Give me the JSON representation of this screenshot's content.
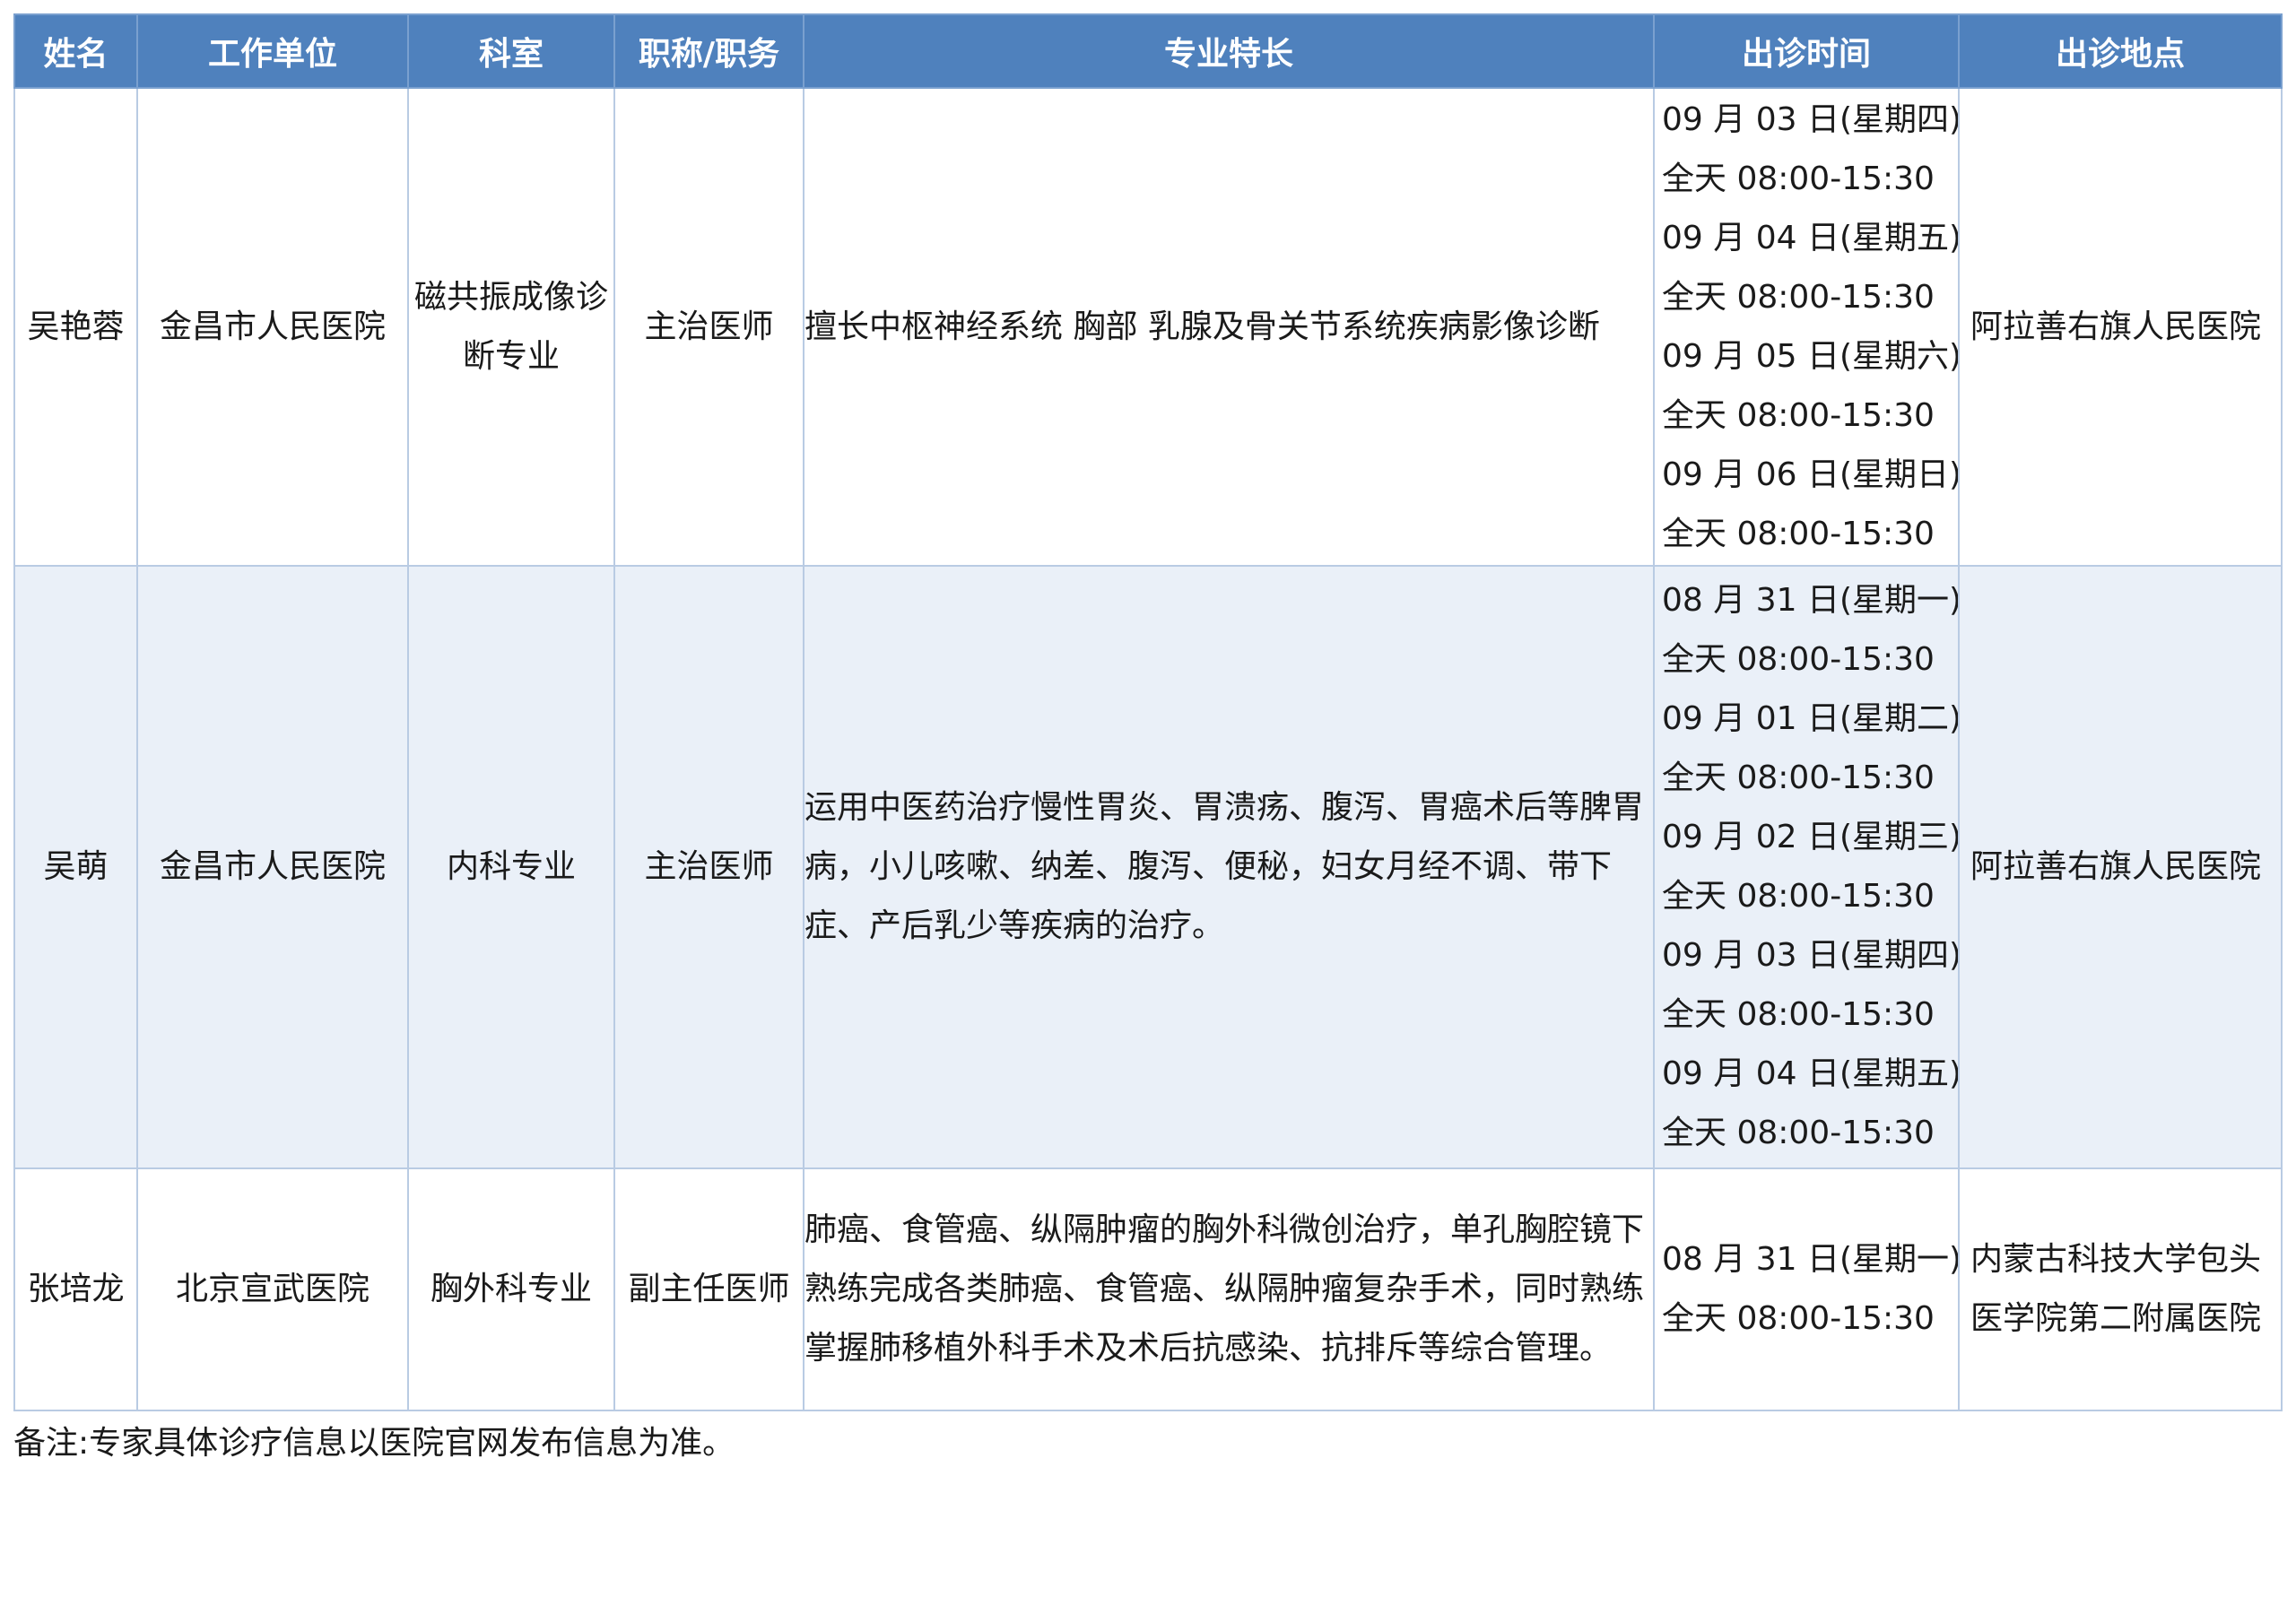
{
  "table": {
    "headers": [
      "姓名",
      "工作单位",
      "科室",
      "职称/职务",
      "专业特长",
      "出诊时间",
      "出诊地点"
    ],
    "rows": [
      {
        "name": "吴艳蓉",
        "unit": "金昌市人民医院",
        "department": "磁共振成像诊断专业",
        "title": "主治医师",
        "specialty": "擅长中枢神经系统 胸部 乳腺及骨关节系统疾病影像诊断",
        "times": [
          "09 月 03 日(星期四)",
          "全天 08:00-15:30",
          "09 月 04 日(星期五)",
          "全天 08:00-15:30",
          "09 月 05 日(星期六)",
          "全天 08:00-15:30",
          "09 月 06 日(星期日)",
          "全天 08:00-15:30"
        ],
        "location": "阿拉善右旗人民医院"
      },
      {
        "name": "吴萌",
        "unit": "金昌市人民医院",
        "department": "内科专业",
        "title": "主治医师",
        "specialty": "运用中医药治疗慢性胃炎、胃溃疡、腹泻、胃癌术后等脾胃病，小儿咳嗽、纳差、腹泻、便秘，妇女月经不调、带下症、产后乳少等疾病的治疗。",
        "times": [
          "08 月 31 日(星期一)",
          "全天 08:00-15:30",
          "09 月 01 日(星期二)",
          "全天 08:00-15:30",
          "09 月 02 日(星期三)",
          "全天 08:00-15:30",
          "09 月 03 日(星期四)",
          "全天 08:00-15:30",
          "09 月 04 日(星期五)",
          "全天 08:00-15:30"
        ],
        "location": "阿拉善右旗人民医院"
      },
      {
        "name": "张培龙",
        "unit": "北京宣武医院",
        "department": "胸外科专业",
        "title": "副主任医师",
        "specialty": "肺癌、食管癌、纵隔肿瘤的胸外科微创治疗，单孔胸腔镜下熟练完成各类肺癌、食管癌、纵隔肿瘤复杂手术，同时熟练掌握肺移植外科手术及术后抗感染、抗排斥等综合管理。",
        "times": [
          "08 月 31 日(星期一)",
          "全天 08:00-15:30"
        ],
        "location": "内蒙古科技大学包头医学院第二附属医院"
      }
    ]
  },
  "note": "备注:专家具体诊疗信息以医院官网发布信息为准。",
  "colors": {
    "header_bg": "#4f81bd",
    "header_text": "#ffffff",
    "shaded_row": "#eaf0f8",
    "grid": "#b9cbe3"
  }
}
